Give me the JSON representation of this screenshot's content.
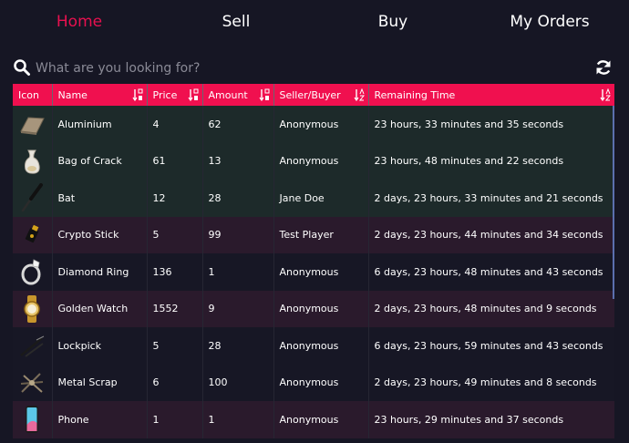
{
  "nav": [
    "Home",
    "Sell",
    "Buy",
    "My Orders"
  ],
  "search": {
    "placeholder": "What are you looking for?"
  },
  "columns": {
    "icon": "Icon",
    "name": "Name",
    "price": "Price",
    "amount": "Amount",
    "seller": "Seller/Buyer",
    "remaining": "Remaining Time"
  },
  "rows": [
    {
      "name": "Aluminium",
      "price": "4",
      "amount": "62",
      "seller": "Anonymous",
      "remaining": "23 hours, 33 minutes and 35 seconds",
      "icon": "aluminium-icon"
    },
    {
      "name": "Bag of Crack",
      "price": "61",
      "amount": "13",
      "seller": "Anonymous",
      "remaining": "23 hours, 48 minutes and 22 seconds",
      "icon": "bag-icon"
    },
    {
      "name": "Bat",
      "price": "12",
      "amount": "28",
      "seller": "Jane Doe",
      "remaining": "2 days, 23 hours, 33 minutes and 21 seconds",
      "icon": "bat-icon"
    },
    {
      "name": "Crypto Stick",
      "price": "5",
      "amount": "99",
      "seller": "Test Player",
      "remaining": "2 days, 23 hours, 44 minutes and 34 seconds",
      "icon": "usb-stick-icon"
    },
    {
      "name": "Diamond Ring",
      "price": "136",
      "amount": "1",
      "seller": "Anonymous",
      "remaining": "6 days, 23 hours, 48 minutes and 43 seconds",
      "icon": "ring-icon"
    },
    {
      "name": "Golden Watch",
      "price": "1552",
      "amount": "9",
      "seller": "Anonymous",
      "remaining": "2 days, 23 hours, 48 minutes and 9 seconds",
      "icon": "watch-icon"
    },
    {
      "name": "Lockpick",
      "price": "5",
      "amount": "28",
      "seller": "Anonymous",
      "remaining": "6 days, 23 hours, 59 minutes and 43 seconds",
      "icon": "lockpick-icon"
    },
    {
      "name": "Metal Scrap",
      "price": "6",
      "amount": "100",
      "seller": "Anonymous",
      "remaining": "2 days, 23 hours, 49 minutes and 8 seconds",
      "icon": "scrap-icon"
    },
    {
      "name": "Phone",
      "price": "1",
      "amount": "1",
      "seller": "Anonymous",
      "remaining": "23 hours, 29 minutes and 37 seconds",
      "icon": "phone-icon"
    }
  ],
  "colors": {
    "accent": "#f0104f",
    "active_nav": "#e8104f",
    "background": "#161624",
    "row_green": "#1d2a2a",
    "row_red": "#2a1a2c"
  }
}
